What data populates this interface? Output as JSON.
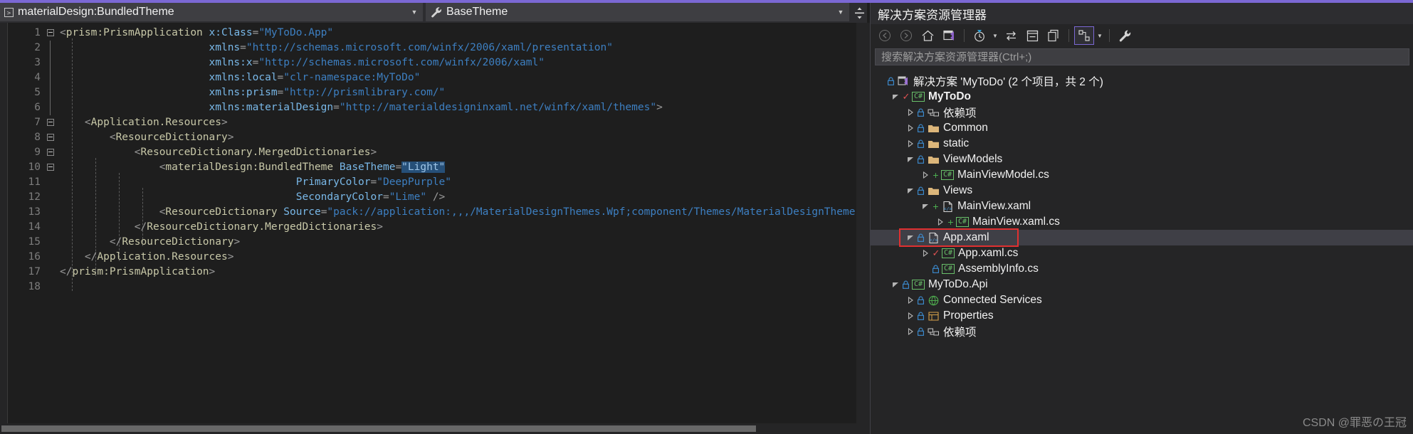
{
  "window": {
    "accent_color": "#7b68d4",
    "background": "#1e1e1e"
  },
  "editor": {
    "nav_bar": {
      "type_dropdown": {
        "value": "materialDesign:BundledTheme",
        "glyph": "code-block-icon",
        "caret": "chevron-down-icon"
      },
      "member_dropdown": {
        "value": "BaseTheme",
        "glyph": "wrench-icon",
        "caret": "chevron-down-icon"
      },
      "splitter": "split-window-icon"
    },
    "line_numbers": [
      "1",
      "2",
      "3",
      "4",
      "5",
      "6",
      "7",
      "8",
      "9",
      "10",
      "11",
      "12",
      "13",
      "14",
      "15",
      "16",
      "17",
      "18"
    ],
    "code_lines": [
      {
        "n": 1,
        "fold": "minus",
        "tokens": [
          {
            "t": "<",
            "c": "tk-pun"
          },
          {
            "t": "prism:PrismApplication",
            "c": "tk-el"
          },
          {
            "t": " ",
            "c": ""
          },
          {
            "t": "x:Class",
            "c": "tk-attr"
          },
          {
            "t": "=",
            "c": "tk-pun"
          },
          {
            "t": "\"MyToDo.App\"",
            "c": "tk-val"
          }
        ]
      },
      {
        "n": 2,
        "fold": "",
        "tokens": [
          {
            "t": "                        ",
            "c": ""
          },
          {
            "t": "xmlns",
            "c": "tk-attr"
          },
          {
            "t": "=",
            "c": "tk-pun"
          },
          {
            "t": "\"http://schemas.microsoft.com/winfx/2006/xaml/presentation\"",
            "c": "tk-val"
          }
        ]
      },
      {
        "n": 3,
        "fold": "",
        "tokens": [
          {
            "t": "                        ",
            "c": ""
          },
          {
            "t": "xmlns:x",
            "c": "tk-attr"
          },
          {
            "t": "=",
            "c": "tk-pun"
          },
          {
            "t": "\"http://schemas.microsoft.com/winfx/2006/xaml\"",
            "c": "tk-val"
          }
        ]
      },
      {
        "n": 4,
        "fold": "",
        "tokens": [
          {
            "t": "                        ",
            "c": ""
          },
          {
            "t": "xmlns:local",
            "c": "tk-attr"
          },
          {
            "t": "=",
            "c": "tk-pun"
          },
          {
            "t": "\"clr-namespace:MyToDo\"",
            "c": "tk-val"
          }
        ]
      },
      {
        "n": 5,
        "fold": "",
        "tokens": [
          {
            "t": "                        ",
            "c": ""
          },
          {
            "t": "xmlns:prism",
            "c": "tk-attr"
          },
          {
            "t": "=",
            "c": "tk-pun"
          },
          {
            "t": "\"http://prismlibrary.com/\"",
            "c": "tk-val"
          }
        ]
      },
      {
        "n": 6,
        "fold": "",
        "tokens": [
          {
            "t": "                        ",
            "c": ""
          },
          {
            "t": "xmlns:materialDesign",
            "c": "tk-attr"
          },
          {
            "t": "=",
            "c": "tk-pun"
          },
          {
            "t": "\"http://materialdesigninxaml.net/winfx/xaml/themes\"",
            "c": "tk-val"
          },
          {
            "t": ">",
            "c": "tk-pun"
          }
        ]
      },
      {
        "n": 7,
        "fold": "minus",
        "tokens": [
          {
            "t": "    ",
            "c": ""
          },
          {
            "t": "<",
            "c": "tk-pun"
          },
          {
            "t": "Application.Resources",
            "c": "tk-el"
          },
          {
            "t": ">",
            "c": "tk-pun"
          }
        ]
      },
      {
        "n": 8,
        "fold": "minus",
        "tokens": [
          {
            "t": "        ",
            "c": ""
          },
          {
            "t": "<",
            "c": "tk-pun"
          },
          {
            "t": "ResourceDictionary",
            "c": "tk-el"
          },
          {
            "t": ">",
            "c": "tk-pun"
          }
        ]
      },
      {
        "n": 9,
        "fold": "minus",
        "tokens": [
          {
            "t": "            ",
            "c": ""
          },
          {
            "t": "<",
            "c": "tk-pun"
          },
          {
            "t": "ResourceDictionary.MergedDictionaries",
            "c": "tk-el"
          },
          {
            "t": ">",
            "c": "tk-pun"
          }
        ]
      },
      {
        "n": 10,
        "fold": "minus",
        "tokens": [
          {
            "t": "                ",
            "c": ""
          },
          {
            "t": "<",
            "c": "tk-pun"
          },
          {
            "t": "materialDesign:BundledTheme",
            "c": "tk-el"
          },
          {
            "t": " ",
            "c": ""
          },
          {
            "t": "BaseTheme",
            "c": "tk-attr"
          },
          {
            "t": "=",
            "c": "tk-pun"
          },
          {
            "t": "\"Light\"",
            "c": "tk-val sel"
          }
        ]
      },
      {
        "n": 11,
        "fold": "",
        "tokens": [
          {
            "t": "                                      ",
            "c": ""
          },
          {
            "t": "PrimaryColor",
            "c": "tk-attr"
          },
          {
            "t": "=",
            "c": "tk-pun"
          },
          {
            "t": "\"DeepPurple\"",
            "c": "tk-val"
          }
        ]
      },
      {
        "n": 12,
        "fold": "",
        "tokens": [
          {
            "t": "                                      ",
            "c": ""
          },
          {
            "t": "SecondaryColor",
            "c": "tk-attr"
          },
          {
            "t": "=",
            "c": "tk-pun"
          },
          {
            "t": "\"Lime\"",
            "c": "tk-val"
          },
          {
            "t": " ",
            "c": ""
          },
          {
            "t": "/>",
            "c": "tk-pun"
          }
        ]
      },
      {
        "n": 13,
        "fold": "",
        "tokens": [
          {
            "t": "                ",
            "c": ""
          },
          {
            "t": "<",
            "c": "tk-pun"
          },
          {
            "t": "ResourceDictionary",
            "c": "tk-el"
          },
          {
            "t": " ",
            "c": ""
          },
          {
            "t": "Source",
            "c": "tk-attr"
          },
          {
            "t": "=",
            "c": "tk-pun"
          },
          {
            "t": "\"pack://application:,,,/MaterialDesignThemes.Wpf;component/Themes/MaterialDesignTheme.",
            "c": "tk-val"
          }
        ]
      },
      {
        "n": 14,
        "fold": "",
        "tokens": [
          {
            "t": "            ",
            "c": ""
          },
          {
            "t": "</",
            "c": "tk-pun"
          },
          {
            "t": "ResourceDictionary.MergedDictionaries",
            "c": "tk-el"
          },
          {
            "t": ">",
            "c": "tk-pun"
          }
        ]
      },
      {
        "n": 15,
        "fold": "",
        "tokens": [
          {
            "t": "        ",
            "c": ""
          },
          {
            "t": "</",
            "c": "tk-pun"
          },
          {
            "t": "ResourceDictionary",
            "c": "tk-el"
          },
          {
            "t": ">",
            "c": "tk-pun"
          }
        ]
      },
      {
        "n": 16,
        "fold": "",
        "tokens": [
          {
            "t": "    ",
            "c": ""
          },
          {
            "t": "</",
            "c": "tk-pun"
          },
          {
            "t": "Application.Resources",
            "c": "tk-el"
          },
          {
            "t": ">",
            "c": "tk-pun"
          }
        ]
      },
      {
        "n": 17,
        "fold": "",
        "tokens": [
          {
            "t": "</",
            "c": "tk-pun"
          },
          {
            "t": "prism:PrismApplication",
            "c": "tk-el"
          },
          {
            "t": ">",
            "c": "tk-pun"
          }
        ]
      },
      {
        "n": 18,
        "fold": "",
        "tokens": []
      }
    ],
    "selection": {
      "text": "Light",
      "color": "#264f78"
    },
    "scrollbars": {
      "vertical": {
        "up_arrow": "chevron-up-icon",
        "down_arrow": "chevron-down-icon"
      },
      "horizontal": true
    }
  },
  "solution_explorer": {
    "title": "解决方案资源管理器",
    "toolbar": [
      {
        "name": "back-icon",
        "glyph": "←",
        "state": "disabled"
      },
      {
        "name": "forward-icon",
        "glyph": "→",
        "state": "disabled"
      },
      {
        "name": "home-icon",
        "glyph": "⌂",
        "state": "normal"
      },
      {
        "name": "vs-solution-icon",
        "glyph": "▤",
        "state": "normal"
      },
      {
        "name": "pending-changes-icon",
        "glyph": "◷",
        "state": "normal",
        "has_caret": true
      },
      {
        "name": "sync-with-active-document-icon",
        "glyph": "⇆",
        "state": "normal"
      },
      {
        "name": "collapse-all-icon",
        "glyph": "⊟",
        "state": "normal"
      },
      {
        "name": "show-all-files-icon",
        "glyph": "❐",
        "state": "normal"
      },
      {
        "name": "properties-view-icon",
        "glyph": "⧉",
        "state": "active",
        "has_caret": true
      },
      {
        "name": "wrench-icon",
        "glyph": "🔧",
        "state": "normal"
      }
    ],
    "search": {
      "placeholder": "搜索解决方案资源管理器(Ctrl+;)",
      "value": ""
    },
    "tree": [
      {
        "depth": 0,
        "expander": "",
        "lock": true,
        "icon": "solution-icon",
        "label": "解决方案 'MyToDo' (2 个项目，共 2 个)",
        "bold": false,
        "selected": false,
        "marked": false
      },
      {
        "depth": 1,
        "expander": "open",
        "lock": false,
        "check": true,
        "icon": "csharp-project-icon",
        "label": "MyToDo",
        "bold": true,
        "selected": false,
        "marked": false
      },
      {
        "depth": 2,
        "expander": "closed",
        "lock": true,
        "icon": "dependencies-icon",
        "label": "依赖项",
        "bold": false,
        "selected": false,
        "marked": false
      },
      {
        "depth": 2,
        "expander": "closed",
        "lock": true,
        "icon": "folder-icon",
        "label": "Common",
        "bold": false,
        "selected": false,
        "marked": false
      },
      {
        "depth": 2,
        "expander": "closed",
        "lock": true,
        "icon": "folder-icon",
        "label": "static",
        "bold": false,
        "selected": false,
        "marked": false
      },
      {
        "depth": 2,
        "expander": "open",
        "lock": true,
        "icon": "folder-icon",
        "label": "ViewModels",
        "bold": false,
        "selected": false,
        "marked": false
      },
      {
        "depth": 3,
        "expander": "closed",
        "lock": false,
        "plus": true,
        "icon": "csharp-file-icon",
        "label": "MainViewModel.cs",
        "bold": false,
        "selected": false,
        "marked": false
      },
      {
        "depth": 2,
        "expander": "open",
        "lock": true,
        "icon": "folder-icon",
        "label": "Views",
        "bold": false,
        "selected": false,
        "marked": false
      },
      {
        "depth": 3,
        "expander": "open",
        "lock": false,
        "plus": true,
        "icon": "xaml-file-icon",
        "label": "MainView.xaml",
        "bold": false,
        "selected": false,
        "marked": false
      },
      {
        "depth": 4,
        "expander": "closed",
        "lock": false,
        "plus": true,
        "icon": "csharp-file-icon",
        "label": "MainView.xaml.cs",
        "bold": false,
        "selected": false,
        "marked": false
      },
      {
        "depth": 2,
        "expander": "open",
        "lock": true,
        "icon": "xaml-file-icon",
        "label": "App.xaml",
        "bold": false,
        "selected": true,
        "marked": true
      },
      {
        "depth": 3,
        "expander": "closed",
        "lock": false,
        "check": true,
        "icon": "csharp-file-icon",
        "label": "App.xaml.cs",
        "bold": false,
        "selected": false,
        "marked": false
      },
      {
        "depth": 3,
        "expander": "",
        "lock": true,
        "icon": "csharp-file-icon",
        "label": "AssemblyInfo.cs",
        "bold": false,
        "selected": false,
        "marked": false
      },
      {
        "depth": 1,
        "expander": "open",
        "lock": true,
        "icon": "csharp-project-icon",
        "label": "MyToDo.Api",
        "bold": false,
        "selected": false,
        "marked": false
      },
      {
        "depth": 2,
        "expander": "closed",
        "lock": true,
        "icon": "connected-services-icon",
        "label": "Connected Services",
        "bold": false,
        "selected": false,
        "marked": false
      },
      {
        "depth": 2,
        "expander": "closed",
        "lock": true,
        "icon": "properties-icon",
        "label": "Properties",
        "bold": false,
        "selected": false,
        "marked": false
      },
      {
        "depth": 2,
        "expander": "closed",
        "lock": true,
        "icon": "dependencies-icon",
        "label": "依赖项",
        "bold": false,
        "selected": false,
        "marked": false
      }
    ],
    "watermark": "CSDN @罪恶の王冠"
  }
}
